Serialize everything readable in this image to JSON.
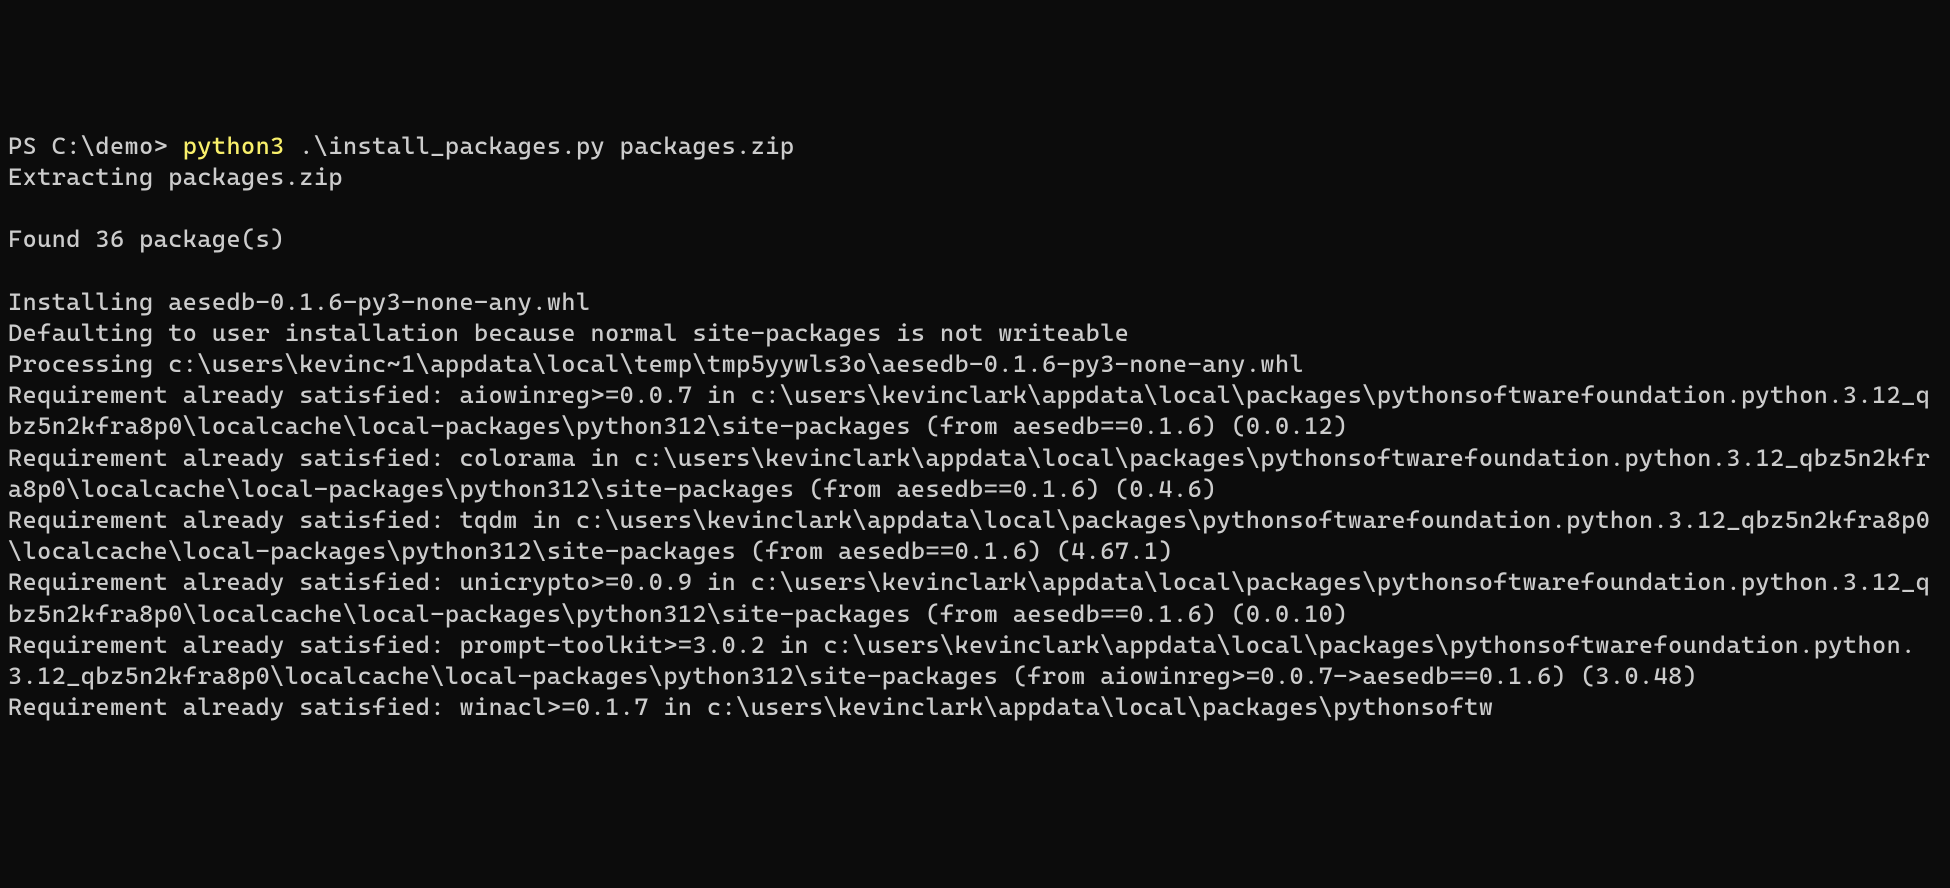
{
  "prompt": {
    "ps": "PS ",
    "path": "C:\\demo> ",
    "command": "python3",
    "args": " .\\install_packages.py packages.zip"
  },
  "output": {
    "line1": "Extracting packages.zip",
    "line2": "",
    "line3": "Found 36 package(s)",
    "line4": "",
    "line5": "Installing aesedb-0.1.6-py3-none-any.whl",
    "line6": "Defaulting to user installation because normal site-packages is not writeable",
    "line7": "Processing c:\\users\\kevinc~1\\appdata\\local\\temp\\tmp5yywls3o\\aesedb-0.1.6-py3-none-any.whl",
    "line8": "Requirement already satisfied: aiowinreg>=0.0.7 in c:\\users\\kevinclark\\appdata\\local\\packages\\pythonsoftwarefoundation.python.3.12_qbz5n2kfra8p0\\localcache\\local-packages\\python312\\site-packages (from aesedb==0.1.6) (0.0.12)",
    "line9": "Requirement already satisfied: colorama in c:\\users\\kevinclark\\appdata\\local\\packages\\pythonsoftwarefoundation.python.3.12_qbz5n2kfra8p0\\localcache\\local-packages\\python312\\site-packages (from aesedb==0.1.6) (0.4.6)",
    "line10": "Requirement already satisfied: tqdm in c:\\users\\kevinclark\\appdata\\local\\packages\\pythonsoftwarefoundation.python.3.12_qbz5n2kfra8p0\\localcache\\local-packages\\python312\\site-packages (from aesedb==0.1.6) (4.67.1)",
    "line11": "Requirement already satisfied: unicrypto>=0.0.9 in c:\\users\\kevinclark\\appdata\\local\\packages\\pythonsoftwarefoundation.python.3.12_qbz5n2kfra8p0\\localcache\\local-packages\\python312\\site-packages (from aesedb==0.1.6) (0.0.10)",
    "line12": "Requirement already satisfied: prompt-toolkit>=3.0.2 in c:\\users\\kevinclark\\appdata\\local\\packages\\pythonsoftwarefoundation.python.3.12_qbz5n2kfra8p0\\localcache\\local-packages\\python312\\site-packages (from aiowinreg>=0.0.7->aesedb==0.1.6) (3.0.48)",
    "line13": "Requirement already satisfied: winacl>=0.1.7 in c:\\users\\kevinclark\\appdata\\local\\packages\\pythonsoftw"
  }
}
